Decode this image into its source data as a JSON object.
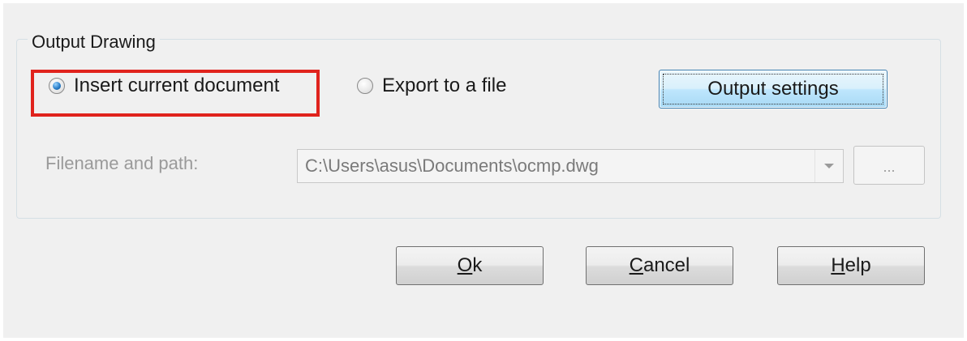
{
  "group": {
    "title": "Output Drawing"
  },
  "options": {
    "insert_label": "Insert current document",
    "insert_selected": true,
    "export_label": "Export to a file",
    "export_selected": false
  },
  "output_settings_label": "Output settings",
  "file": {
    "label": "Filename and path:",
    "value": "C:\\Users\\asus\\Documents\\ocmp.dwg",
    "browse_label": "..."
  },
  "buttons": {
    "ok": {
      "accel": "O",
      "rest": "k"
    },
    "cancel": {
      "accel": "C",
      "rest": "ancel"
    },
    "help": {
      "accel": "H",
      "rest": "elp"
    }
  },
  "colors": {
    "highlight": "#e0231d",
    "dialog_bg": "#f0f0f0",
    "disabled_text": "#9a9a9a"
  },
  "icons": {
    "combo_arrow": "chevron-down-icon"
  }
}
